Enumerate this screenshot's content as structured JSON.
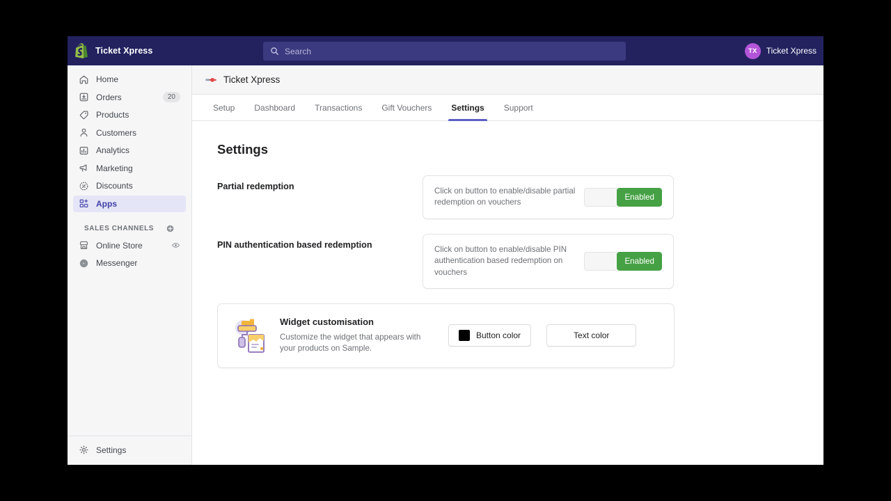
{
  "topbar": {
    "logo_icon": "shopify-bag-icon",
    "store_name": "Ticket Xpress",
    "search": {
      "icon": "search-icon",
      "placeholder": "Search",
      "value": ""
    },
    "user": {
      "initials": "TX",
      "name": "Ticket Xpress"
    },
    "bg_color": "#23225f",
    "search_bg_color": "#3b3a80",
    "avatar_color": "#b355d8"
  },
  "sidebar": {
    "items": [
      {
        "label": "Home",
        "icon": "home-icon",
        "badge": "",
        "active": false
      },
      {
        "label": "Orders",
        "icon": "orders-inbox-icon",
        "badge": "20",
        "active": false
      },
      {
        "label": "Products",
        "icon": "product-tag-icon",
        "badge": "",
        "active": false
      },
      {
        "label": "Customers",
        "icon": "customer-person-icon",
        "badge": "",
        "active": false
      },
      {
        "label": "Analytics",
        "icon": "analytics-bar-chart-icon",
        "badge": "",
        "active": false
      },
      {
        "label": "Marketing",
        "icon": "marketing-megaphone-icon",
        "badge": "",
        "active": false
      },
      {
        "label": "Discounts",
        "icon": "discount-percent-icon",
        "badge": "",
        "active": false
      },
      {
        "label": "Apps",
        "icon": "apps-grid-plus-icon",
        "badge": "",
        "active": true
      }
    ],
    "section": {
      "title": "Sales channels",
      "add_icon": "plus-circle-icon"
    },
    "channels": [
      {
        "label": "Online Store",
        "icon": "online-store-icon",
        "trailing_icon": "eye-icon"
      },
      {
        "label": "Messenger",
        "icon": "messenger-icon",
        "trailing_icon": ""
      }
    ],
    "footer": {
      "label": "Settings",
      "icon": "gear-icon"
    },
    "active_bg_color": "#e4e5f7",
    "active_text_color": "#3f3fa6"
  },
  "app_header": {
    "icon": "ticket-xpress-app-icon",
    "title": "Ticket Xpress"
  },
  "tabs": [
    {
      "label": "Setup",
      "active": false
    },
    {
      "label": "Dashboard",
      "active": false
    },
    {
      "label": "Transactions",
      "active": false
    },
    {
      "label": "Gift Vouchers",
      "active": false
    },
    {
      "label": "Settings",
      "active": true
    },
    {
      "label": "Support",
      "active": false
    }
  ],
  "tab_accent_color": "#5c5fc4",
  "page": {
    "title": "Settings",
    "settings": [
      {
        "label": "Partial redemption",
        "description": "Click on button to enable/disable partial redemption on vouchers",
        "toggle_state_label": "Enabled",
        "toggle_on_color": "#45a144"
      },
      {
        "label": "PIN authentication based redemption",
        "description": "Click on button to enable/disable PIN authentication based redemption on vouchers",
        "toggle_state_label": "Enabled",
        "toggle_on_color": "#45a144"
      }
    ],
    "widget": {
      "illustration_icon": "paint-roller-illustration",
      "title": "Widget customisation",
      "subtitle": "Customize the widget that appears with your products on Sample.",
      "buttons": [
        {
          "label": "Button color",
          "swatch_color": "#000000",
          "swatch_icon": "color-swatch"
        },
        {
          "label": "Text color",
          "swatch_color": "#ffffff",
          "swatch_icon": "color-swatch"
        }
      ]
    }
  }
}
